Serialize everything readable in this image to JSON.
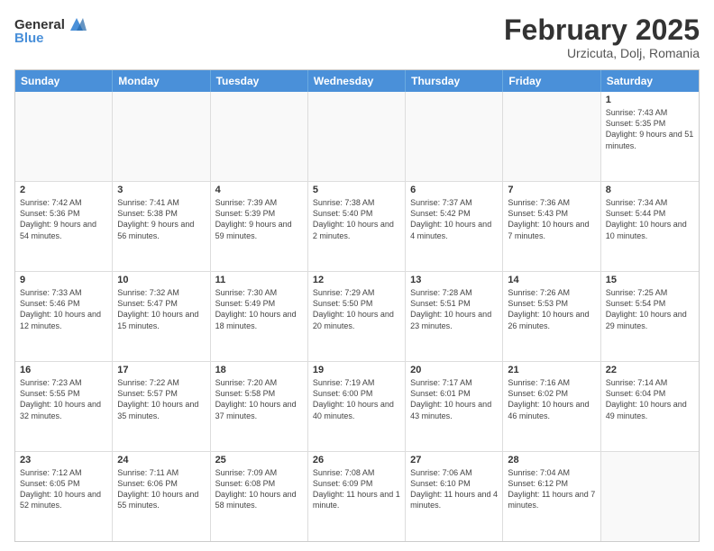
{
  "logo": {
    "general": "General",
    "blue": "Blue"
  },
  "title": "February 2025",
  "subtitle": "Urzicuta, Dolj, Romania",
  "header_days": [
    "Sunday",
    "Monday",
    "Tuesday",
    "Wednesday",
    "Thursday",
    "Friday",
    "Saturday"
  ],
  "weeks": [
    [
      {
        "day": "",
        "info": ""
      },
      {
        "day": "",
        "info": ""
      },
      {
        "day": "",
        "info": ""
      },
      {
        "day": "",
        "info": ""
      },
      {
        "day": "",
        "info": ""
      },
      {
        "day": "",
        "info": ""
      },
      {
        "day": "1",
        "info": "Sunrise: 7:43 AM\nSunset: 5:35 PM\nDaylight: 9 hours and 51 minutes."
      }
    ],
    [
      {
        "day": "2",
        "info": "Sunrise: 7:42 AM\nSunset: 5:36 PM\nDaylight: 9 hours and 54 minutes."
      },
      {
        "day": "3",
        "info": "Sunrise: 7:41 AM\nSunset: 5:38 PM\nDaylight: 9 hours and 56 minutes."
      },
      {
        "day": "4",
        "info": "Sunrise: 7:39 AM\nSunset: 5:39 PM\nDaylight: 9 hours and 59 minutes."
      },
      {
        "day": "5",
        "info": "Sunrise: 7:38 AM\nSunset: 5:40 PM\nDaylight: 10 hours and 2 minutes."
      },
      {
        "day": "6",
        "info": "Sunrise: 7:37 AM\nSunset: 5:42 PM\nDaylight: 10 hours and 4 minutes."
      },
      {
        "day": "7",
        "info": "Sunrise: 7:36 AM\nSunset: 5:43 PM\nDaylight: 10 hours and 7 minutes."
      },
      {
        "day": "8",
        "info": "Sunrise: 7:34 AM\nSunset: 5:44 PM\nDaylight: 10 hours and 10 minutes."
      }
    ],
    [
      {
        "day": "9",
        "info": "Sunrise: 7:33 AM\nSunset: 5:46 PM\nDaylight: 10 hours and 12 minutes."
      },
      {
        "day": "10",
        "info": "Sunrise: 7:32 AM\nSunset: 5:47 PM\nDaylight: 10 hours and 15 minutes."
      },
      {
        "day": "11",
        "info": "Sunrise: 7:30 AM\nSunset: 5:49 PM\nDaylight: 10 hours and 18 minutes."
      },
      {
        "day": "12",
        "info": "Sunrise: 7:29 AM\nSunset: 5:50 PM\nDaylight: 10 hours and 20 minutes."
      },
      {
        "day": "13",
        "info": "Sunrise: 7:28 AM\nSunset: 5:51 PM\nDaylight: 10 hours and 23 minutes."
      },
      {
        "day": "14",
        "info": "Sunrise: 7:26 AM\nSunset: 5:53 PM\nDaylight: 10 hours and 26 minutes."
      },
      {
        "day": "15",
        "info": "Sunrise: 7:25 AM\nSunset: 5:54 PM\nDaylight: 10 hours and 29 minutes."
      }
    ],
    [
      {
        "day": "16",
        "info": "Sunrise: 7:23 AM\nSunset: 5:55 PM\nDaylight: 10 hours and 32 minutes."
      },
      {
        "day": "17",
        "info": "Sunrise: 7:22 AM\nSunset: 5:57 PM\nDaylight: 10 hours and 35 minutes."
      },
      {
        "day": "18",
        "info": "Sunrise: 7:20 AM\nSunset: 5:58 PM\nDaylight: 10 hours and 37 minutes."
      },
      {
        "day": "19",
        "info": "Sunrise: 7:19 AM\nSunset: 6:00 PM\nDaylight: 10 hours and 40 minutes."
      },
      {
        "day": "20",
        "info": "Sunrise: 7:17 AM\nSunset: 6:01 PM\nDaylight: 10 hours and 43 minutes."
      },
      {
        "day": "21",
        "info": "Sunrise: 7:16 AM\nSunset: 6:02 PM\nDaylight: 10 hours and 46 minutes."
      },
      {
        "day": "22",
        "info": "Sunrise: 7:14 AM\nSunset: 6:04 PM\nDaylight: 10 hours and 49 minutes."
      }
    ],
    [
      {
        "day": "23",
        "info": "Sunrise: 7:12 AM\nSunset: 6:05 PM\nDaylight: 10 hours and 52 minutes."
      },
      {
        "day": "24",
        "info": "Sunrise: 7:11 AM\nSunset: 6:06 PM\nDaylight: 10 hours and 55 minutes."
      },
      {
        "day": "25",
        "info": "Sunrise: 7:09 AM\nSunset: 6:08 PM\nDaylight: 10 hours and 58 minutes."
      },
      {
        "day": "26",
        "info": "Sunrise: 7:08 AM\nSunset: 6:09 PM\nDaylight: 11 hours and 1 minute."
      },
      {
        "day": "27",
        "info": "Sunrise: 7:06 AM\nSunset: 6:10 PM\nDaylight: 11 hours and 4 minutes."
      },
      {
        "day": "28",
        "info": "Sunrise: 7:04 AM\nSunset: 6:12 PM\nDaylight: 11 hours and 7 minutes."
      },
      {
        "day": "",
        "info": ""
      }
    ]
  ]
}
